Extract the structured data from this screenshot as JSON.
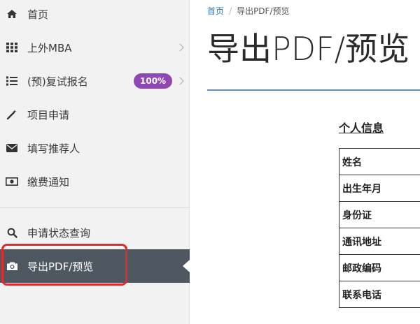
{
  "sidebar": {
    "items": [
      {
        "label": "首页",
        "icon": "home-icon"
      },
      {
        "label": "上外MBA",
        "icon": "grid-icon"
      },
      {
        "label": "(预)复试报名",
        "icon": "list-icon",
        "badge": "100%"
      },
      {
        "label": "项目申请",
        "icon": "magic-wand-icon"
      },
      {
        "label": "填写推荐人",
        "icon": "envelope-icon"
      },
      {
        "label": "缴费通知",
        "icon": "money-icon"
      },
      {
        "label": "申请状态查询",
        "icon": "search-icon"
      },
      {
        "label": "导出PDF/预览",
        "icon": "camera-icon"
      }
    ]
  },
  "breadcrumb": {
    "home": "首页",
    "current": "导出PDF/预览"
  },
  "page": {
    "title": "导出PDF/预览"
  },
  "document": {
    "section_title": "个人信息",
    "rows": [
      "姓名",
      "出生年月",
      "身份证",
      "通讯地址",
      "邮政编码",
      "联系电话"
    ]
  },
  "colors": {
    "accent": "#2a7ab8",
    "badge": "#8f47b3",
    "active_bg": "#4f5761",
    "highlight": "#e02b2b"
  }
}
